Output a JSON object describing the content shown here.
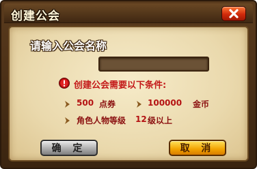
{
  "dialog": {
    "title": "创建公会",
    "close_icon": "close-icon"
  },
  "form": {
    "prompt": "请输入公会名称",
    "name_value": "",
    "name_placeholder": ""
  },
  "conditions": {
    "title": "创建公会需要以下条件:",
    "cost_amount_1": "500",
    "cost_unit_1": "点券",
    "cost_amount_2": "100000",
    "cost_unit_2": "金币",
    "level_text_prefix": "角色人物等级",
    "level_value": "12",
    "level_text_suffix": "级以上"
  },
  "buttons": {
    "ok_label": "确 定",
    "cancel_label": "取 消"
  },
  "colors": {
    "frame_brown": "#3a2410",
    "panel_parchment": "#ead9ad",
    "condition_red": "#c31818",
    "cancel_gold": "#f2a300",
    "close_red": "#d12a0b"
  }
}
